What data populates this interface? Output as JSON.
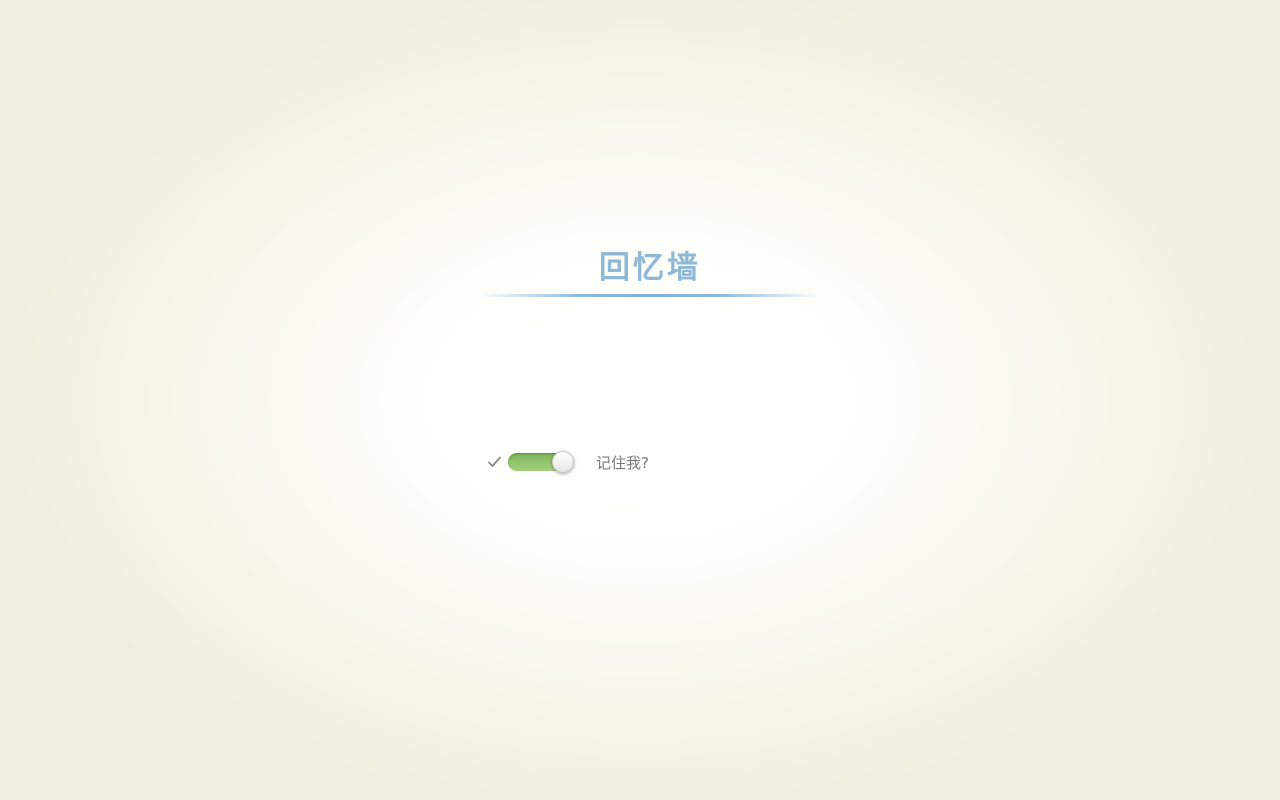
{
  "brand": {
    "title": "回忆墙",
    "accent_color": "#8fb7d6"
  },
  "remember_me": {
    "label": "记住我?",
    "checked": true,
    "check_icon": "checkmark-icon",
    "toggle_color": "#8fc26a"
  }
}
